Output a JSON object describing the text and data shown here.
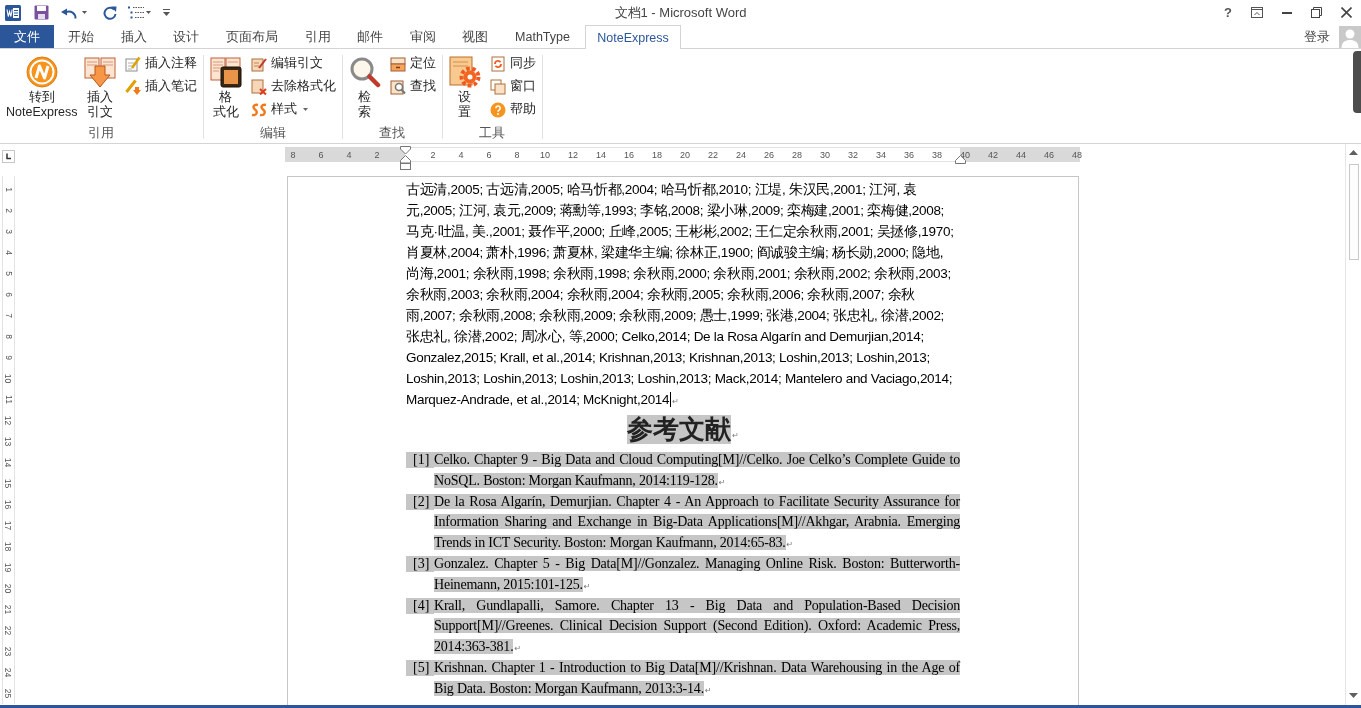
{
  "window": {
    "title": "文档1 - Microsoft Word",
    "help": "?"
  },
  "tabs": [
    {
      "label": "文件",
      "kind": "file",
      "selected": false
    },
    {
      "label": "开始",
      "kind": "normal",
      "selected": false
    },
    {
      "label": "插入",
      "kind": "normal",
      "selected": false
    },
    {
      "label": "设计",
      "kind": "normal",
      "selected": false
    },
    {
      "label": "页面布局",
      "kind": "normal",
      "selected": false
    },
    {
      "label": "引用",
      "kind": "normal",
      "selected": false
    },
    {
      "label": "邮件",
      "kind": "normal",
      "selected": false
    },
    {
      "label": "审阅",
      "kind": "normal",
      "selected": false
    },
    {
      "label": "视图",
      "kind": "normal",
      "selected": false
    },
    {
      "label": "MathType",
      "kind": "normal",
      "selected": false
    },
    {
      "label": "NoteExpress",
      "kind": "normal",
      "selected": true
    }
  ],
  "account": {
    "sign_in": "登录"
  },
  "ribbon": {
    "groups": [
      {
        "label": "引用",
        "large": [
          {
            "lines": [
              "转到",
              "NoteExpress"
            ]
          },
          {
            "lines": [
              "插入",
              "引文"
            ]
          }
        ],
        "small": [
          {
            "label": "插入注释",
            "dropdown": false
          },
          {
            "label": "插入笔记",
            "dropdown": false
          }
        ]
      },
      {
        "label": "编辑",
        "large": [
          {
            "lines": [
              "格",
              "式化"
            ]
          }
        ],
        "small": [
          {
            "label": "编辑引文",
            "dropdown": false
          },
          {
            "label": "去除格式化",
            "dropdown": false
          },
          {
            "label": "样式",
            "dropdown": true
          }
        ]
      },
      {
        "label": "查找",
        "large": [
          {
            "lines": [
              "检",
              "索"
            ]
          }
        ],
        "small": [
          {
            "label": "定位",
            "dropdown": false
          },
          {
            "label": "查找",
            "dropdown": false
          }
        ]
      },
      {
        "label": "工具",
        "large": [
          {
            "lines": [
              "设",
              "置"
            ]
          }
        ],
        "small": [
          {
            "label": "同步",
            "dropdown": false
          },
          {
            "label": "窗口",
            "dropdown": false
          },
          {
            "label": "帮助",
            "dropdown": false
          }
        ]
      }
    ]
  },
  "ruler": {
    "left_labels": [
      "8",
      "6",
      "4",
      "2"
    ],
    "labels": [
      "2",
      "4",
      "6",
      "8",
      "10",
      "12",
      "14",
      "16",
      "18",
      "20",
      "22",
      "24",
      "26",
      "28",
      "30",
      "32",
      "34",
      "36",
      "38"
    ],
    "right_labels": [
      "40",
      "42",
      "44",
      "46",
      "48"
    ]
  },
  "vertical_ruler": {
    "labels": [
      "1",
      "2",
      "3",
      "4",
      "5",
      "6",
      "7",
      "8",
      "9",
      "10",
      "11",
      "12",
      "13",
      "14",
      "15",
      "16",
      "17",
      "18",
      "19",
      "20",
      "21",
      "22",
      "23",
      "24",
      "25"
    ]
  },
  "document": {
    "body": {
      "text": "古远清,2005; 古远清,2005; 哈马忻都,2004; 哈马忻都,2010; 江堤, 朱汉民,2001; 江河, 袁元,2005; 江河, 袁元,2009; 蒋勳等,1993; 李铭,2008; 梁小琳,2009; 栾梅建,2001; 栾梅健,2008; 马克·吐温, 美.,2001; 聂作平,2000; 丘峰,2005; 王彬彬,2002; 王仁定余秋雨,2001; 吴拯修,1970; 肖夏林,2004; 萧朴,1996; 萧夏林, 梁建华主编; 徐林正,1900; 阎诚骏主编; 杨长勋,2000; 隐地, 尚海,2001; 余秋雨,1998; 余秋雨,1998; 余秋雨,2000; 余秋雨,2001; 余秋雨,2002; 余秋雨,2003; 余秋雨,2003; 余秋雨,2004; 余秋雨,2004; 余秋雨,2005; 余秋雨,2006; 余秋雨,2007; 余秋雨,2007; 余秋雨,2008; 余秋雨,2009; 余秋雨,2009; 愚士,1999; 张港,2004; 张忠礼, 徐潜,2002; 张忠礼, 徐潜,2002; 周冰心, 等,2000; Celko,2014; De la Rosa Algarín and Demurjian,2014; Gonzalez,2015; Krall, et al.,2014; Krishnan,2013; Krishnan,2013; Loshin,2013; Loshin,2013; Loshin,2013; Loshin,2013; Loshin,2013; Loshin,2013; Mack,2014; Mantelero and Vaciago,2014; Marquez-Andrade, et al.,2014; McKnight,2014",
      "mark": "↵",
      "cursor": true
    },
    "heading": {
      "text": "参考文献",
      "mark": "↵"
    },
    "references": [
      {
        "number": "[1]",
        "text": "Celko. Chapter 9 - Big Data and Cloud Computing[M]//Celko. Joe Celko’s Complete Guide to NoSQL. Boston: Morgan Kaufmann, 2014:119-128.",
        "mark": "↵"
      },
      {
        "number": "[2]",
        "text": "De la Rosa Algarín, Demurjian. Chapter 4 - An Approach to Facilitate Security Assurance for Information Sharing and Exchange in Big-Data Applications[M]//Akhgar, Arabnia. Emerging Trends in ICT Security. Boston: Morgan Kaufmann, 2014:65-83.",
        "mark": "↵"
      },
      {
        "number": "[3]",
        "text": "Gonzalez. Chapter 5 - Big Data[M]//Gonzalez. Managing Online Risk. Boston: Butterworth-Heinemann, 2015:101-125.",
        "mark": "↵"
      },
      {
        "number": "[4]",
        "text": "Krall, Gundlapalli, Samore. Chapter 13 - Big Data and Population-Based Decision Support[M]//Greenes. Clinical Decision Support (Second Edition). Oxford: Academic Press, 2014:363-381.",
        "mark": "↵"
      },
      {
        "number": "[5]",
        "text": "Krishnan. Chapter 1 - Introduction to Big Data[M]//Krishnan. Data Warehousing in the Age of Big Data. Boston: Morgan Kaufmann, 2013:3-14.",
        "mark": "↵"
      }
    ]
  }
}
